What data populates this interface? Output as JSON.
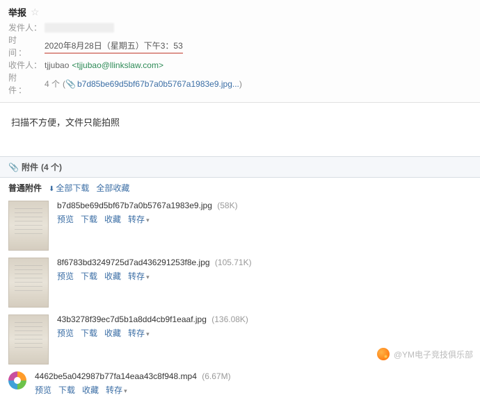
{
  "header": {
    "subject": "举报",
    "sender_label": "发件人：",
    "time_label": "时　间：",
    "time_value": "2020年8月28日（星期五）下午3：53",
    "recipient_label": "收件人：",
    "recipient_name": "tjjubao",
    "recipient_email": "<tjjubao@llinkslaw.com>",
    "attach_label": "附　件：",
    "attach_count_text": "4 个",
    "attach_preview_name": "b7d85be69d5bf67b7a0b5767a1983e9.jpg..."
  },
  "body_text": "扫描不方便，文件只能拍照",
  "attach_section": {
    "title": "附件",
    "count_text": "(4 个)",
    "toolbar": {
      "label": "普通附件",
      "download_all": "全部下载",
      "save_all": "全部收藏"
    },
    "actions": {
      "preview": "预览",
      "download": "下载",
      "save": "收藏",
      "forward": "转存"
    },
    "items": [
      {
        "name": "b7d85be69d5bf67b7a0b5767a1983e9.jpg",
        "size": "(58K)",
        "type": "image"
      },
      {
        "name": "8f6783bd3249725d7ad436291253f8e.jpg",
        "size": "(105.71K)",
        "type": "image"
      },
      {
        "name": "43b3278f39ec7d5b1a8dd4cb9f1eaaf.jpg",
        "size": "(136.08K)",
        "type": "image"
      },
      {
        "name": "4462be5a042987b77fa14eaa43c8f948.mp4",
        "size": "(6.67M)",
        "type": "video"
      }
    ]
  },
  "watermark": "@YM电子竞技俱乐部"
}
